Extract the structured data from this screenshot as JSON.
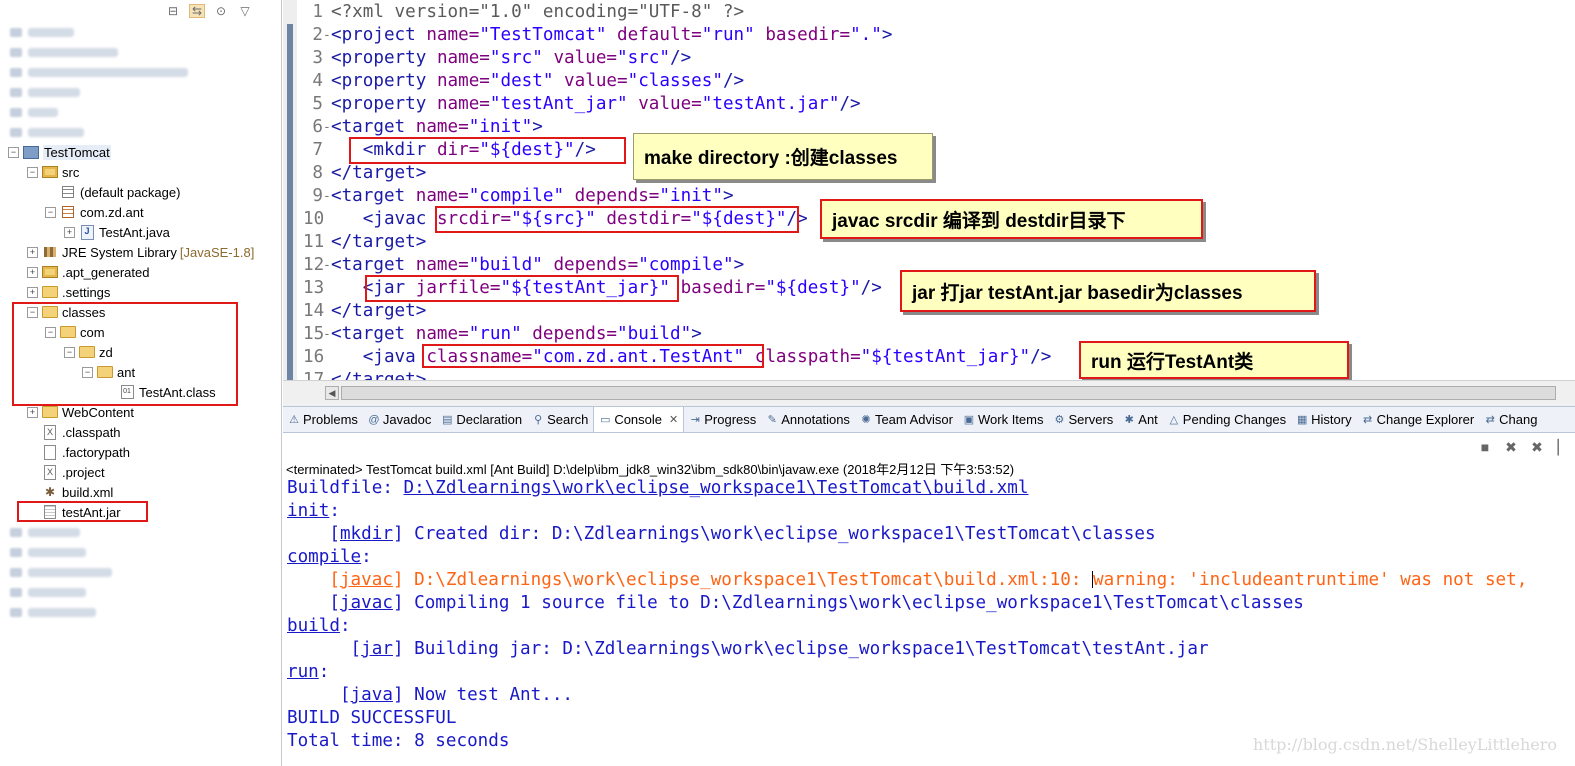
{
  "explorer": {
    "toolbar": [
      "collapse-all-icon",
      "link-with-editor-icon",
      "focus-icon",
      "view-menu-icon"
    ],
    "project": "TestTomcat",
    "src": "src",
    "default_package": "(default package)",
    "package": "com.zd.ant",
    "java_file": "TestAnt.java",
    "jre_library": "JRE System Library",
    "jre_suffix": "[JavaSE-1.8]",
    "apt_generated": ".apt_generated",
    "settings": ".settings",
    "classes": "classes",
    "com": "com",
    "zd": "zd",
    "ant": "ant",
    "class_file": "TestAnt.class",
    "webcontent": "WebContent",
    "classpath": ".classpath",
    "factorypath": ".factorypath",
    "project_file": ".project",
    "build_xml": "build.xml",
    "jar_file": "testAnt.jar"
  },
  "editor": {
    "lines": [
      {
        "n": "1",
        "fold": "",
        "parts": [
          [
            "pi",
            "<?xml version=\"1.0\" encoding=\"UTF-8\" ?>"
          ]
        ]
      },
      {
        "n": "2",
        "fold": "⊖",
        "parts": [
          [
            "tag",
            "<project "
          ],
          [
            "attr",
            "name="
          ],
          [
            "val",
            "\"TestTomcat\""
          ],
          [
            "attr",
            " default="
          ],
          [
            "val",
            "\"run\""
          ],
          [
            "attr",
            " basedir="
          ],
          [
            "val",
            "\".\""
          ],
          [
            "tag",
            ">"
          ]
        ]
      },
      {
        "n": "3",
        "fold": "",
        "parts": [
          [
            "tag",
            "<property "
          ],
          [
            "attr",
            "name="
          ],
          [
            "val",
            "\"src\""
          ],
          [
            "attr",
            " value="
          ],
          [
            "val",
            "\"src\""
          ],
          [
            "tag",
            "/>"
          ]
        ]
      },
      {
        "n": "4",
        "fold": "",
        "parts": [
          [
            "tag",
            "<property "
          ],
          [
            "attr",
            "name="
          ],
          [
            "val",
            "\"dest\""
          ],
          [
            "attr",
            " value="
          ],
          [
            "val",
            "\"classes\""
          ],
          [
            "tag",
            "/>"
          ]
        ]
      },
      {
        "n": "5",
        "fold": "",
        "parts": [
          [
            "tag",
            "<property "
          ],
          [
            "attr",
            "name="
          ],
          [
            "val",
            "\"testAnt_jar\""
          ],
          [
            "attr",
            " value="
          ],
          [
            "val",
            "\"testAnt.jar\""
          ],
          [
            "tag",
            "/>"
          ]
        ]
      },
      {
        "n": "6",
        "fold": "⊖",
        "parts": [
          [
            "tag",
            "<target "
          ],
          [
            "attr",
            "name="
          ],
          [
            "val",
            "\"init\""
          ],
          [
            "tag",
            ">"
          ]
        ]
      },
      {
        "n": "7",
        "fold": "",
        "parts": [
          [
            "plain",
            "   "
          ],
          [
            "tag",
            "<mkdir "
          ],
          [
            "attr",
            "dir="
          ],
          [
            "val",
            "\"${dest}\""
          ],
          [
            "tag",
            "/>"
          ]
        ]
      },
      {
        "n": "8",
        "fold": "",
        "parts": [
          [
            "tag",
            "</target>"
          ]
        ]
      },
      {
        "n": "9",
        "fold": "⊖",
        "parts": [
          [
            "tag",
            "<target "
          ],
          [
            "attr",
            "name="
          ],
          [
            "val",
            "\"compile\""
          ],
          [
            "attr",
            " depends="
          ],
          [
            "val",
            "\"init\""
          ],
          [
            "tag",
            ">"
          ]
        ]
      },
      {
        "n": "10",
        "fold": "",
        "parts": [
          [
            "plain",
            "   "
          ],
          [
            "tag",
            "<javac "
          ],
          [
            "attr",
            "srcdir="
          ],
          [
            "val",
            "\"${src}\""
          ],
          [
            "attr",
            " destdir="
          ],
          [
            "val",
            "\"${dest}\""
          ],
          [
            "tag",
            "/>"
          ]
        ]
      },
      {
        "n": "11",
        "fold": "",
        "parts": [
          [
            "tag",
            "</target>"
          ]
        ]
      },
      {
        "n": "12",
        "fold": "⊖",
        "parts": [
          [
            "tag",
            "<target "
          ],
          [
            "attr",
            "name="
          ],
          [
            "val",
            "\"build\""
          ],
          [
            "attr",
            " depends="
          ],
          [
            "val",
            "\"compile\""
          ],
          [
            "tag",
            ">"
          ]
        ]
      },
      {
        "n": "13",
        "fold": "",
        "parts": [
          [
            "plain",
            "   "
          ],
          [
            "tag",
            "<jar "
          ],
          [
            "attr",
            "jarfile="
          ],
          [
            "val",
            "\"${testAnt_jar}\""
          ],
          [
            "attr",
            " basedir="
          ],
          [
            "val",
            "\"${dest}\""
          ],
          [
            "tag",
            "/>"
          ]
        ]
      },
      {
        "n": "14",
        "fold": "",
        "parts": [
          [
            "tag",
            "</target>"
          ]
        ]
      },
      {
        "n": "15",
        "fold": "⊖",
        "parts": [
          [
            "tag",
            "<target "
          ],
          [
            "attr",
            "name="
          ],
          [
            "val",
            "\"run\""
          ],
          [
            "attr",
            " depends="
          ],
          [
            "val",
            "\"build\""
          ],
          [
            "tag",
            ">"
          ]
        ]
      },
      {
        "n": "16",
        "fold": "",
        "parts": [
          [
            "plain",
            "   "
          ],
          [
            "tag",
            "<java "
          ],
          [
            "attr",
            "classname="
          ],
          [
            "val",
            "\"com.zd.ant.TestAnt\""
          ],
          [
            "attr",
            " classpath="
          ],
          [
            "val",
            "\"${testAnt_jar}\""
          ],
          [
            "tag",
            "/>"
          ]
        ]
      },
      {
        "n": "17",
        "fold": "",
        "parts": [
          [
            "tag",
            "</target>"
          ]
        ]
      }
    ],
    "callouts": {
      "mkdir": "make directory :创建classes",
      "javac": "javac  srcdir 编译到 destdir目录下",
      "jar": "jar 打jar  testAnt.jar  basedir为classes",
      "run": "run 运行TestAnt类"
    }
  },
  "tabs": [
    {
      "label": "Problems",
      "icon": "problems-icon"
    },
    {
      "label": "Javadoc",
      "icon": "javadoc-icon"
    },
    {
      "label": "Declaration",
      "icon": "declaration-icon"
    },
    {
      "label": "Search",
      "icon": "search-icon"
    },
    {
      "label": "Console",
      "icon": "console-icon",
      "active": true
    },
    {
      "label": "Progress",
      "icon": "progress-icon"
    },
    {
      "label": "Annotations",
      "icon": "annotations-icon"
    },
    {
      "label": "Team Advisor",
      "icon": "team-advisor-icon"
    },
    {
      "label": "Work Items",
      "icon": "work-items-icon"
    },
    {
      "label": "Servers",
      "icon": "servers-icon"
    },
    {
      "label": "Ant",
      "icon": "ant-icon"
    },
    {
      "label": "Pending Changes",
      "icon": "pending-changes-icon"
    },
    {
      "label": "History",
      "icon": "history-icon"
    },
    {
      "label": "Change Explorer",
      "icon": "change-explorer-icon"
    },
    {
      "label": "Chang",
      "icon": "change-icon"
    }
  ],
  "console": {
    "status": "<terminated> TestTomcat build.xml [Ant Build] D:\\delp\\ibm_jdk8_win32\\ibm_sdk80\\bin\\javaw.exe (2018年2月12日 下午3:53:52)",
    "buildfile_label": "Buildfile: ",
    "buildfile_path": "D:\\Zdlearnings\\work\\eclipse_workspace1\\TestTomcat\\build.xml",
    "init": "init",
    "mkdir_tag": "mkdir",
    "mkdir_msg": " Created dir: D:\\Zdlearnings\\work\\eclipse_workspace1\\TestTomcat\\classes",
    "compile": "compile",
    "javac_tag": "javac",
    "javac_warn_path": " D:\\Zdlearnings\\work\\eclipse_workspace1\\TestTomcat\\build.xml:10: ",
    "javac_warn_msg": "warning: 'includeantruntime' was not set,",
    "javac_msg": " Compiling 1 source file to D:\\Zdlearnings\\work\\eclipse_workspace1\\TestTomcat\\classes",
    "build": "build",
    "jar_tag": "jar",
    "jar_msg": " Building jar: D:\\Zdlearnings\\work\\eclipse_workspace1\\TestTomcat\\testAnt.jar",
    "run": "run",
    "java_tag": "java",
    "java_msg": " Now test Ant...",
    "success": "BUILD SUCCESSFUL",
    "total": "Total time: 8 seconds"
  },
  "watermark": "http://blog.csdn.net/ShelleyLittlehero",
  "colors": {
    "tag": "#1a1aa6",
    "attr": "#7f007f",
    "value": "#2a00ff",
    "console_text": "#1919c8",
    "console_warning": "#ff6414",
    "highlight_box": "#e01818",
    "callout_bg": "#ffffc0"
  }
}
